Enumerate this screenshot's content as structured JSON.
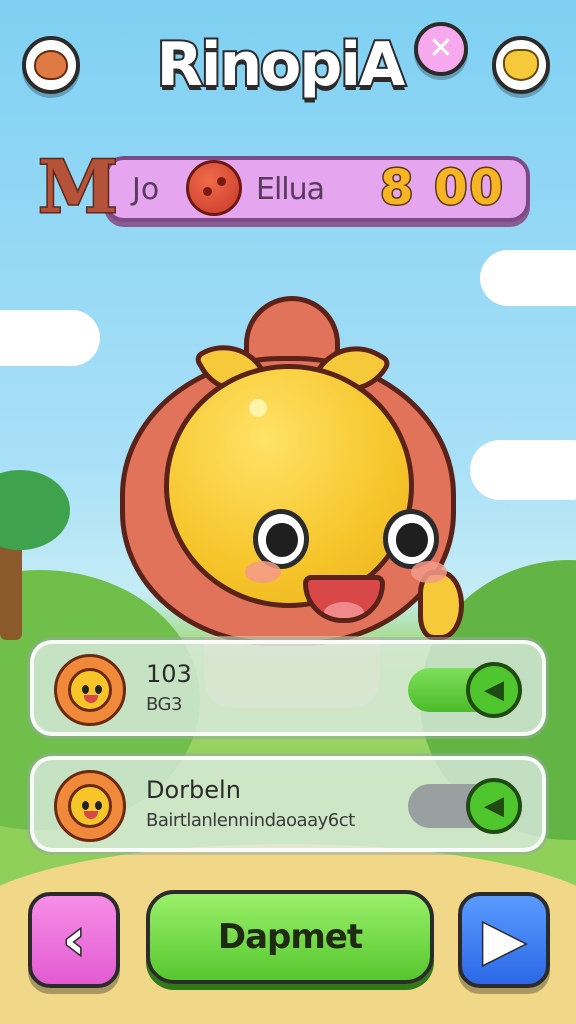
{
  "game": {
    "title": "RinopiA"
  },
  "top_bar": {
    "left_button_icon": "fox-face-icon",
    "close_button_icon": "close-x-icon",
    "right_button_icon": "cat-face-icon"
  },
  "stats": {
    "badge_letter": "M",
    "label_1": "Jo",
    "coin_icon": "red-coin-icon",
    "label_2": "Ellua",
    "value": "8 00"
  },
  "cards": [
    {
      "avatar_icon": "orange-mascot-icon",
      "title": "103",
      "subtitle": "BG3",
      "toggle_state": "on"
    },
    {
      "avatar_icon": "orange-mascot-icon",
      "title": "Dorbeln",
      "subtitle": "Bairtlanlennindaoaay6ct",
      "toggle_state": "off"
    }
  ],
  "controls": {
    "prev_icon": "chevron-left-icon",
    "main_label": "Dapmet",
    "next_icon": "play-right-icon"
  },
  "colors": {
    "sky": "#7fd0f3",
    "grass": "#8fcf5a",
    "stat_bar": "#e5a6ef",
    "main_button": "#56c72e",
    "prev_button": "#e35bd2",
    "next_button": "#2c68e6"
  }
}
